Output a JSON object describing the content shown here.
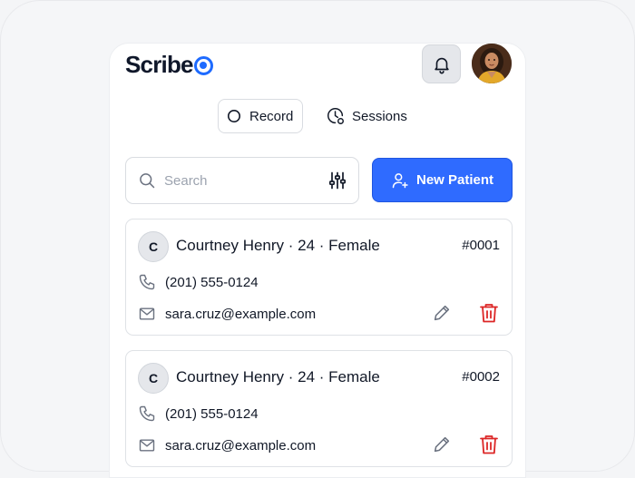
{
  "app": {
    "logo_text": "Scribe",
    "brand_color": "#1e6bff"
  },
  "header": {
    "notification_icon": "bell-icon",
    "avatar_icon": "user-avatar"
  },
  "tabs": [
    {
      "label": "Record",
      "icon": "record-circle-icon",
      "selected": true
    },
    {
      "label": "Sessions",
      "icon": "clock-icon",
      "selected": false
    }
  ],
  "search": {
    "placeholder": "Search",
    "icon": "search-icon",
    "filter_icon": "filter-sliders-icon"
  },
  "new_patient_button": {
    "label": "New Patient",
    "icon": "user-plus-icon",
    "color": "#2f6bff"
  },
  "patients": [
    {
      "initial": "C",
      "summary": "Courtney Henry · 24 · Female",
      "id": "#0001",
      "phone": "(201) 555-0124",
      "email": "sara.cruz@example.com"
    },
    {
      "initial": "C",
      "summary": "Courtney Henry · 24 · Female",
      "id": "#0002",
      "phone": "(201) 555-0124",
      "email": "sara.cruz@example.com"
    }
  ],
  "colors": {
    "delete": "#dc2626",
    "icon_gray": "#6b7280"
  }
}
